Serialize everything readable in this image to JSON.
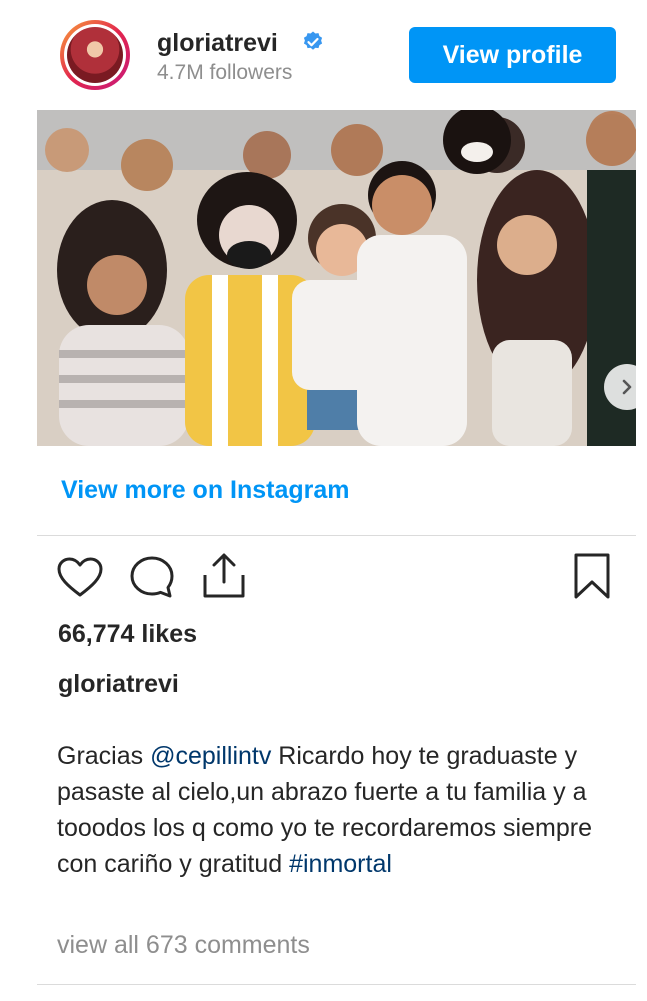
{
  "header": {
    "username": "gloriatrevi",
    "followers": "4.7M followers",
    "view_profile_label": "View profile"
  },
  "post": {
    "carousel_count": 2,
    "carousel_active": 1
  },
  "view_more_label": "View more on Instagram",
  "likes": "66,774 likes",
  "caption": {
    "username": "gloriatrevi",
    "prefix": "Gracias ",
    "mention": "@cepillintv",
    "body": " Ricardo hoy te graduaste y pasaste al cielo,un abrazo fuerte a tu familia y a tooodos los q como yo te recordaremos siempre con cariño y gratitud ",
    "hashtag": "#inmortal"
  },
  "comments_link": "view all 673 comments",
  "colors": {
    "accent": "#0095f6",
    "link_dark": "#00376b",
    "muted": "#8e8e8e",
    "text": "#262626"
  },
  "icons": [
    "heart-icon",
    "comment-icon",
    "share-icon",
    "bookmark-icon",
    "verified-icon",
    "chevron-right-icon"
  ]
}
